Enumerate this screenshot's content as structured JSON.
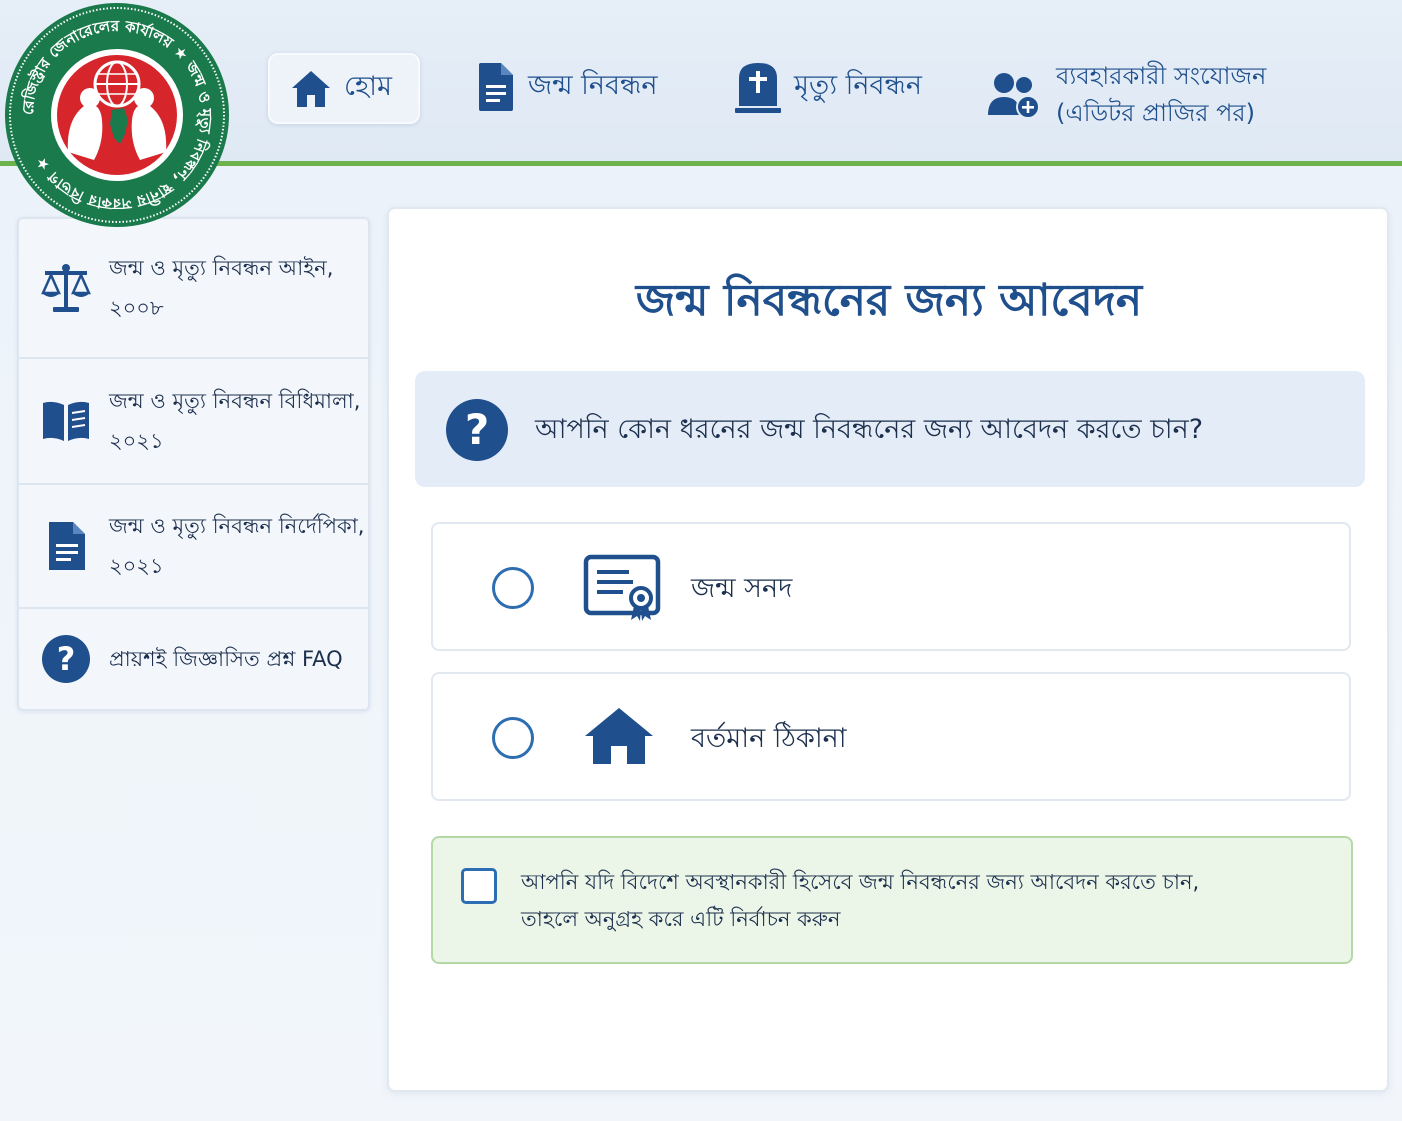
{
  "logo": {
    "ring_text": "রেজিস্ট্রার জেনারেলের কার্যালয় ★ জন্ম ও মৃত্যু নিবন্ধন, স্থানীয় সরকার বিভাগ ★",
    "colors": {
      "ring": "#1a7a4c",
      "center": "#d6262c"
    }
  },
  "nav": {
    "home": "হোম",
    "birth": "জন্ম নিবন্ধন",
    "death": "মৃত্যু নিবন্ধন",
    "user_line1": "ব্যবহারকারী সংযোজন",
    "user_line2": "(এডিটর প্রাজির পর)"
  },
  "sidebar": {
    "items": [
      {
        "line1": "জন্ম ও মৃত্যু নিবন্ধন আইন,",
        "line2": "২০০৮",
        "icon": "scale-icon"
      },
      {
        "line1": "জন্ম ও মৃত্যু নিবন্ধন বিধিমালা,",
        "line2": "২০২১",
        "icon": "book-icon"
      },
      {
        "line1": "জন্ম ও মৃত্যু নিবন্ধন নির্দেপিকা,",
        "line2": "২০২১",
        "icon": "document-icon"
      },
      {
        "line1": "প্রায়শই জিজ্ঞাসিত প্রশ্ন FAQ",
        "icon": "question-icon"
      }
    ]
  },
  "main": {
    "title": "জন্ম নিবন্ধনের জন্য আবেদন",
    "question": "আপনি কোন ধরনের জন্ম নিবন্ধনের জন্য আবেদন করতে চান?",
    "options": [
      {
        "label": "জন্ম সনদ",
        "icon": "certificate-icon",
        "selected": false
      },
      {
        "label": "বর্তমান ঠিকানা",
        "icon": "home-icon",
        "selected": false
      }
    ],
    "abroad": {
      "line1": "আপনি যদি বিদেশে অবস্থানকারী হিসেবে জন্ম নিবন্ধনের জন্য আবেদন করতে চান,",
      "line2": "তাহলে অনুগ্রহ করে এটি নির্বাচন করুন",
      "checked": false
    }
  },
  "colors": {
    "primary": "#1f4f8c",
    "accent_green": "#6bb34a",
    "radio": "#2d6db2"
  }
}
